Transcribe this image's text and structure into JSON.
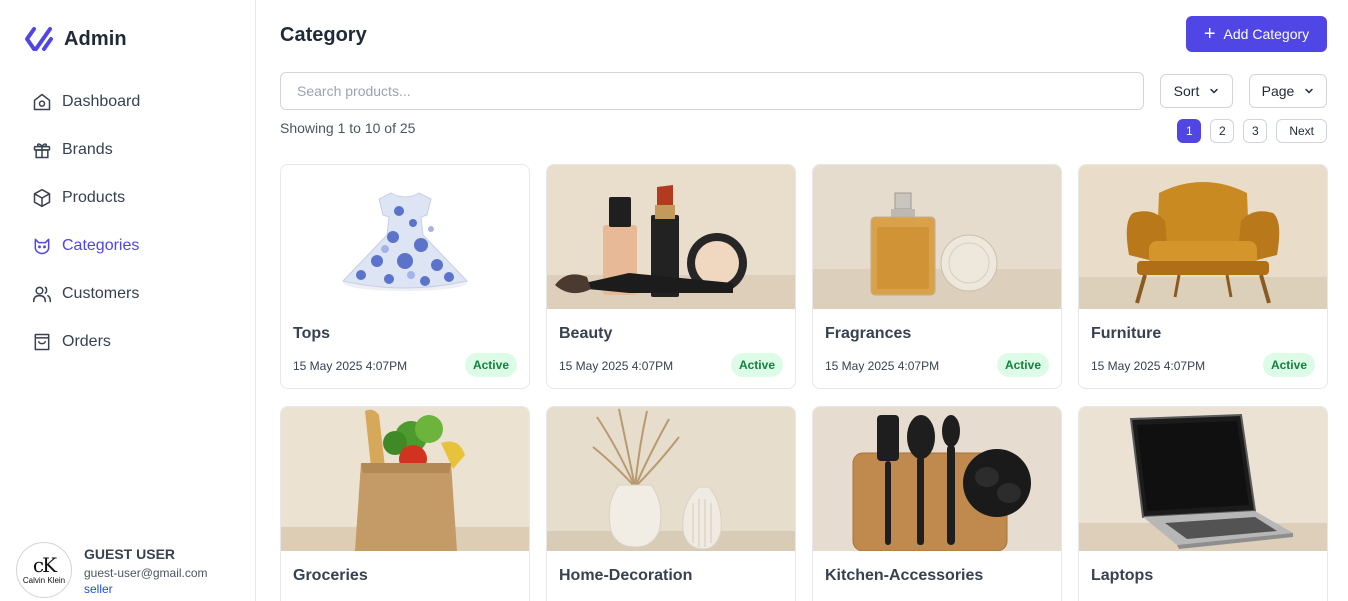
{
  "app": {
    "name": "Admin"
  },
  "sidebar": {
    "items": [
      {
        "label": "Dashboard",
        "icon": "home-icon",
        "active": false
      },
      {
        "label": "Brands",
        "icon": "gift-icon",
        "active": false
      },
      {
        "label": "Products",
        "icon": "box-icon",
        "active": false
      },
      {
        "label": "Categories",
        "icon": "cat-icon",
        "active": true
      },
      {
        "label": "Customers",
        "icon": "users-icon",
        "active": false
      },
      {
        "label": "Orders",
        "icon": "shopping-bag-icon",
        "active": false
      }
    ]
  },
  "user": {
    "name": "GUEST USER",
    "email": "guest-user@gmail.com",
    "role": "seller",
    "avatar_mark": "cK",
    "avatar_text": "Calvin Klein"
  },
  "header": {
    "title": "Category",
    "add_label": "Add Category"
  },
  "search": {
    "placeholder": "Search products...",
    "value": ""
  },
  "controls": {
    "sort_label": "Sort",
    "page_label": "Page"
  },
  "pagination": {
    "showing": "Showing 1 to 10 of 25",
    "pages": [
      "1",
      "2",
      "3"
    ],
    "current": "1",
    "next_label": "Next"
  },
  "colors": {
    "accent": "#4f46e5",
    "badge_bg": "#dcfce7",
    "badge_text": "#15803d"
  },
  "categories": [
    {
      "name": "Tops",
      "date": "15 May 2025 4:07PM",
      "status": "Active",
      "image": "dress-image"
    },
    {
      "name": "Beauty",
      "date": "15 May 2025 4:07PM",
      "status": "Active",
      "image": "cosmetics-image"
    },
    {
      "name": "Fragrances",
      "date": "15 May 2025 4:07PM",
      "status": "Active",
      "image": "perfume-image"
    },
    {
      "name": "Furniture",
      "date": "15 May 2025 4:07PM",
      "status": "Active",
      "image": "armchair-image"
    },
    {
      "name": "Groceries",
      "date": "",
      "status": "",
      "image": "grocery-bag-image"
    },
    {
      "name": "Home-Decoration",
      "date": "",
      "status": "",
      "image": "vases-image"
    },
    {
      "name": "Kitchen-Accessories",
      "date": "",
      "status": "",
      "image": "utensils-image"
    },
    {
      "name": "Laptops",
      "date": "",
      "status": "",
      "image": "laptop-image"
    }
  ]
}
